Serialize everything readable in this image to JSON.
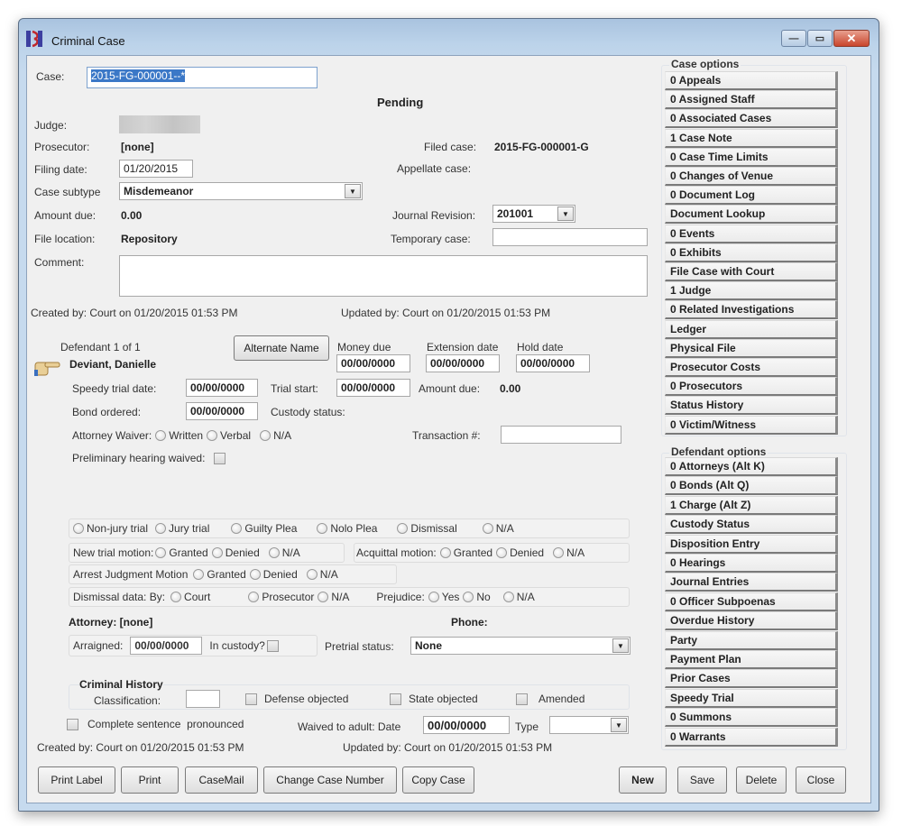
{
  "window": {
    "title": "Criminal Case",
    "controls": {
      "minimize": "—",
      "maximize": "▭",
      "close": "✕"
    }
  },
  "case": {
    "case_label": "Case:",
    "case_value": "2015-FG-000001--*",
    "status": "Pending",
    "judge_label": "Judge:",
    "prosecutor_label": "Prosecutor:",
    "prosecutor_value": "[none]",
    "filing_date_label": "Filing date:",
    "filing_date_value": "01/20/2015",
    "subtype_label": "Case subtype",
    "subtype_value": "Misdemeanor",
    "amount_due_label": "Amount due:",
    "amount_due_value": "0.00",
    "file_location_label": "File location:",
    "file_location_value": "Repository",
    "comment_label": "Comment:",
    "comment_value": "",
    "filed_case_label": "Filed case:",
    "filed_case_value": "2015-FG-000001-G",
    "appellate_case_label": "Appellate case:",
    "journal_revision_label": "Journal Revision:",
    "journal_revision_value": "201001",
    "temporary_case_label": "Temporary case:",
    "temporary_case_value": "",
    "created_by": "Created by: Court on 01/20/2015 01:53 PM",
    "updated_by": "Updated by: Court on 01/20/2015 01:53 PM"
  },
  "defendant": {
    "counter": "Defendant 1 of 1",
    "name": "Deviant, Danielle",
    "alternate_name_button": "Alternate Name",
    "money_due_label": "Money due",
    "money_due_value": "00/00/0000",
    "extension_date_label": "Extension date",
    "extension_date_value": "00/00/0000",
    "hold_date_label": "Hold date",
    "hold_date_value": "00/00/0000",
    "speedy_trial_label": "Speedy trial date:",
    "speedy_trial_value": "00/00/0000",
    "trial_start_label": "Trial start:",
    "trial_start_value": "00/00/0000",
    "amount_due_label": "Amount due:",
    "amount_due_value": "0.00",
    "bond_ordered_label": "Bond ordered:",
    "bond_ordered_value": "00/00/0000",
    "custody_status_label": "Custody status:",
    "attorney_waiver_label": "Attorney Waiver:",
    "attorney_waiver_options": [
      "Written",
      "Verbal",
      "N/A"
    ],
    "transaction_label": "Transaction #:",
    "transaction_value": "",
    "prelim_hearing_label": "Preliminary hearing waived:"
  },
  "disposition": {
    "trial_options": [
      "Non-jury trial",
      "Jury trial",
      "Guilty Plea",
      "Nolo Plea",
      "Dismissal",
      "N/A"
    ],
    "new_trial_label": "New trial motion:",
    "new_trial_options": [
      "Granted",
      "Denied",
      "N/A"
    ],
    "acquittal_label": "Acquittal motion:",
    "acquittal_options": [
      "Granted",
      "Denied",
      "N/A"
    ],
    "arrest_judgment_label": "Arrest Judgment Motion",
    "arrest_judgment_options": [
      "Granted",
      "Denied",
      "N/A"
    ],
    "dismissal_label": "Dismissal data:  By:",
    "dismissal_options": [
      "Court",
      "Prosecutor",
      "N/A"
    ],
    "prejudice_label": "Prejudice:",
    "prejudice_options": [
      "Yes",
      "No",
      "N/A"
    ],
    "attorney_label": "Attorney: [none]",
    "phone_label": "Phone:",
    "arraigned_label": "Arraigned:",
    "arraigned_value": "00/00/0000",
    "in_custody_label": "In custody?",
    "pretrial_status_label": "Pretrial status:",
    "pretrial_status_value": "None"
  },
  "criminal_history": {
    "title": "Criminal History",
    "classification_label": "Classification:",
    "classification_value": "",
    "defense_objected": "Defense objected",
    "state_objected": "State objected",
    "amended": "Amended",
    "complete_sentence": "Complete sentence  pronounced",
    "waived_label": "Waived to adult: Date",
    "waived_date": "00/00/0000",
    "type_label": "Type",
    "type_value": "",
    "created_by": "Created by: Court on 01/20/2015 01:53 PM",
    "updated_by": "Updated by: Court on 01/20/2015 01:53 PM"
  },
  "case_options": {
    "title": "Case options",
    "items": [
      "0 Appeals",
      "0 Assigned Staff",
      "0 Associated Cases",
      "1 Case Note",
      "0 Case Time Limits",
      "0 Changes of Venue",
      "0 Document Log",
      "Document Lookup",
      "0 Events",
      "0 Exhibits",
      "File Case with Court",
      "1 Judge",
      "0 Related Investigations",
      "Ledger",
      "Physical File",
      "Prosecutor Costs",
      "0 Prosecutors",
      "Status History",
      "0 Victim/Witness"
    ]
  },
  "defendant_options": {
    "title": "Defendant options",
    "items": [
      "0 Attorneys (Alt K)",
      "0 Bonds (Alt Q)",
      "1 Charge (Alt Z)",
      "Custody Status",
      "Disposition Entry",
      "0 Hearings",
      "Journal Entries",
      "0 Officer Subpoenas",
      "Overdue History",
      "Party",
      "Payment Plan",
      "Prior Cases",
      "Speedy Trial",
      "0 Summons",
      "0 Warrants"
    ]
  },
  "footer": {
    "print_label": "Print Label",
    "print": "Print",
    "casemail": "CaseMail",
    "change_case_number": "Change Case Number",
    "copy_case": "Copy Case",
    "new": "New",
    "save": "Save",
    "delete": "Delete",
    "close": "Close"
  }
}
